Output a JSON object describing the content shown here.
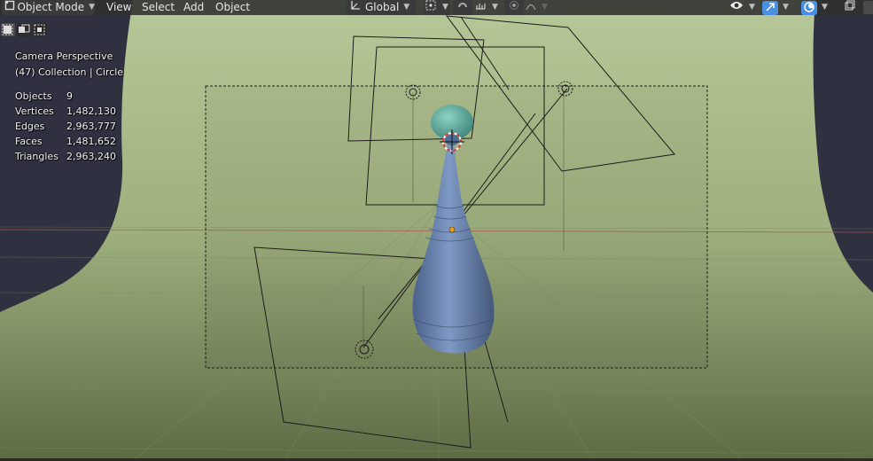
{
  "header": {
    "mode_label": "Object Mode",
    "menus": [
      "View",
      "Select",
      "Add",
      "Object"
    ],
    "transform_orientation": "Global"
  },
  "overlay": {
    "view_name": "Camera Perspective",
    "collection_path": "(47) Collection | Circle"
  },
  "stats": [
    {
      "label": "Objects",
      "value": "9"
    },
    {
      "label": "Vertices",
      "value": "1,482,130"
    },
    {
      "label": "Edges",
      "value": "2,963,777"
    },
    {
      "label": "Faces",
      "value": "1,481,652"
    },
    {
      "label": "Triangles",
      "value": "2,963,240"
    }
  ],
  "colors": {
    "header_bg": "#303030",
    "backdrop_green": "#a3b483",
    "vase_blue": "#6f8bb5",
    "vase_top_teal": "#5aa59a",
    "accent_blue": "#4a8ee0"
  }
}
